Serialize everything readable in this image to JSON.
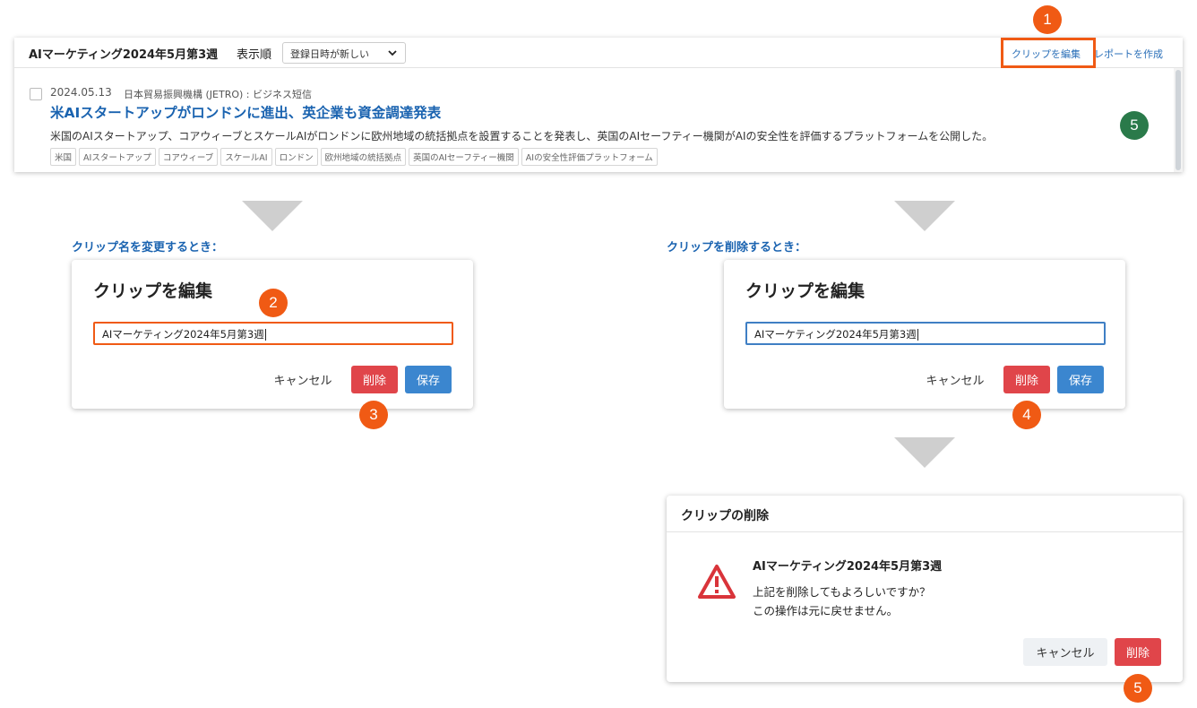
{
  "top_panel": {
    "clip_title": "AIマーケティング2024年5月第3週",
    "sort_label": "表示順",
    "sort_selected": "登録日時が新しい",
    "edit_link": "クリップを編集",
    "report_link": "レポートを作成",
    "article": {
      "date": "2024.05.13",
      "source": "日本貿易振興機構 (JETRO) : ビジネス短信",
      "headline": "米AIスタートアップがロンドンに進出、英企業も資金調達発表",
      "summary": "米国のAIスタートアップ、コアウィーブとスケールAIがロンドンに欧州地域の統括拠点を設置することを発表し、英国のAIセーフティー機関がAIの安全性を評価するプラットフォームを公開した。",
      "tags": [
        "米国",
        "AIスタートアップ",
        "コアウィーブ",
        "スケールAI",
        "ロンドン",
        "欧州地域の統括拠点",
        "英国のAIセーフティー機関",
        "AIの安全性評価プラットフォーム"
      ]
    }
  },
  "badges": {
    "b1": "1",
    "b2": "2",
    "b3": "3",
    "b4": "4",
    "b5_top": "5",
    "b5_bottom": "5"
  },
  "rename_section": {
    "caption": "クリップ名を変更するとき：",
    "dialog_title": "クリップを編集",
    "field_value": "AIマーケティング2024年5月第3週",
    "cancel_label": "キャンセル",
    "delete_label": "削除",
    "save_label": "保存"
  },
  "delete_section": {
    "caption": "クリップを削除するとき：",
    "dialog_title": "クリップを編集",
    "field_value": "AIマーケティング2024年5月第3週",
    "cancel_label": "キャンセル",
    "delete_label": "削除",
    "save_label": "保存"
  },
  "confirm_dialog": {
    "title": "クリップの削除",
    "clip_name": "AIマーケティング2024年5月第3週",
    "message_line1": "上記を削除してもよろしいですか？",
    "message_line2": "この操作は元に戻せません。",
    "cancel_label": "キャンセル",
    "delete_label": "削除"
  },
  "colors": {
    "accent_orange": "#f05a14",
    "link_blue": "#1a63b0",
    "danger_red": "#e0454a",
    "primary_blue": "#3b86cf",
    "badge_green": "#2a7a4a",
    "warning_red": "#d9343a"
  }
}
